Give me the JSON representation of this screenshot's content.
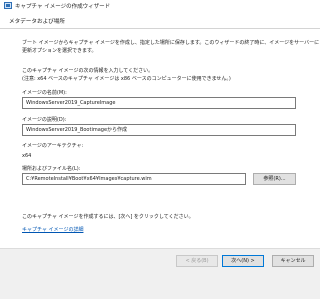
{
  "window": {
    "title": "キャプチャ イメージの作成ウィザード"
  },
  "step": {
    "title": "メタデータおよび場所"
  },
  "intro": {
    "line1": "ブート イメージからキャプチャ イメージを作成し、指定した場所に保存します。このウィザードの終了時に、イメージをサーバーに",
    "line2": "更新オプションを選択できます。"
  },
  "info": {
    "line1": "このキャプチャ イメージの次の情報を入力してください。",
    "line2": "(注意: x64 ベースのキャプチャ イメージは x86 ベースのコンピューターに使用できません。)"
  },
  "image_name": {
    "label": "イメージの名前(M):",
    "value": "WindowsServer2019_CaptureImage"
  },
  "image_description": {
    "label": "イメージの説明(D):",
    "value": "WindowsServer2019_Bootimageから作成"
  },
  "architecture": {
    "label": "イメージのアーキテクチャ:",
    "value": "x64"
  },
  "location": {
    "label": "場所およびファイル名(L):",
    "value": "C:¥RemoteInstall¥Boot¥x64¥Images¥capture.wim",
    "browse_label": "参照(R)..."
  },
  "bottom": {
    "instruction": "このキャプチャ イメージを作成するには、[次へ] をクリックしてください。",
    "link": "キャプチャ イメージの詳細"
  },
  "buttons": {
    "back": "< 戻る(B)",
    "next": "次へ(N) >",
    "cancel": "キャンセル"
  },
  "colors": {
    "link": "#0056b3",
    "primary_border": "#0078d7",
    "footer_bg": "#f0f0f0"
  }
}
